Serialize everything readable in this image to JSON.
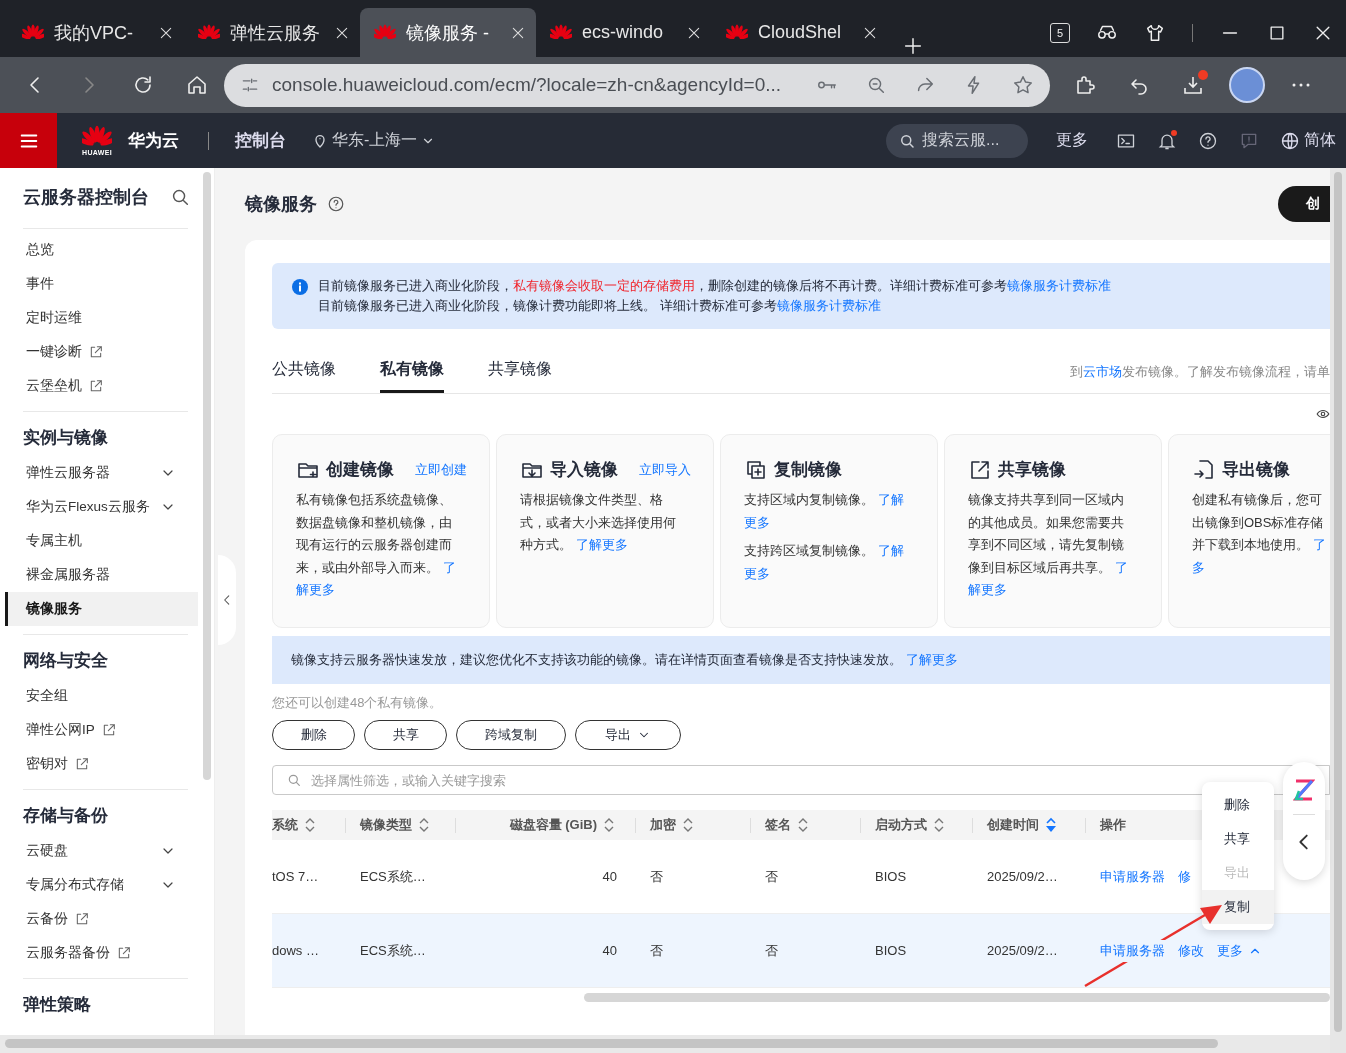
{
  "browser": {
    "tabs": [
      {
        "title": "我的VPC-",
        "selected": false
      },
      {
        "title": "弹性云服务",
        "selected": false
      },
      {
        "title": "镜像服务 -",
        "selected": true
      },
      {
        "title": "ecs-windo",
        "selected": false
      },
      {
        "title": "CloudShel",
        "selected": false
      }
    ],
    "tab_count": "5",
    "url": "console.huaweicloud.com/ecm/?locale=zh-cn&agencyId=0..."
  },
  "header": {
    "logo_text": "HUAWEI",
    "brand": "华为云",
    "console": "控制台",
    "region": "华东-上海一",
    "search_placeholder": "搜索云服...",
    "more": "更多",
    "language": "简体"
  },
  "sidebar": {
    "title": "云服务器控制台",
    "groups": [
      {
        "items": [
          {
            "label": "总览",
            "kind": "link",
            "selected": false
          },
          {
            "label": "事件",
            "kind": "link",
            "selected": false
          },
          {
            "label": "定时运维",
            "kind": "link",
            "selected": false
          },
          {
            "label": "一键诊断",
            "kind": "external",
            "selected": false
          },
          {
            "label": "云堡垒机",
            "kind": "external",
            "selected": false
          }
        ]
      },
      {
        "title": "实例与镜像",
        "items": [
          {
            "label": "弹性云服务器",
            "kind": "expandable",
            "selected": false
          },
          {
            "label": "华为云Flexus云服务",
            "kind": "expandable",
            "selected": false
          },
          {
            "label": "专属主机",
            "kind": "link",
            "selected": false
          },
          {
            "label": "裸金属服务器",
            "kind": "link",
            "selected": false
          },
          {
            "label": "镜像服务",
            "kind": "link",
            "selected": true
          }
        ]
      },
      {
        "title": "网络与安全",
        "items": [
          {
            "label": "安全组",
            "kind": "link",
            "selected": false
          },
          {
            "label": "弹性公网IP",
            "kind": "external",
            "selected": false
          },
          {
            "label": "密钥对",
            "kind": "external",
            "selected": false
          }
        ]
      },
      {
        "title": "存储与备份",
        "items": [
          {
            "label": "云硬盘",
            "kind": "expandable",
            "selected": false
          },
          {
            "label": "专属分布式存储",
            "kind": "expandable",
            "selected": false
          },
          {
            "label": "云备份",
            "kind": "external",
            "selected": false
          },
          {
            "label": "云服务器备份",
            "kind": "external",
            "selected": false
          }
        ]
      },
      {
        "title": "弹性策略"
      }
    ]
  },
  "page": {
    "title": "镜像服务",
    "create_button": "创"
  },
  "notice": [
    [
      {
        "kind": "text",
        "text": "目前镜像服务已进入商业化阶段，"
      },
      {
        "kind": "warning",
        "text": "私有镜像会收取一定的存储费用"
      },
      {
        "kind": "text",
        "text": "，删除创建的镜像后将不再计费。详细计费标准可参考"
      },
      {
        "kind": "link",
        "text": "镜像服务计费标准"
      }
    ],
    [
      {
        "kind": "text",
        "text": "目前镜像服务已进入商业化阶段，镜像计费功能即将上线。 详细计费标准可参考"
      },
      {
        "kind": "link",
        "text": "镜像服务计费标准"
      }
    ]
  ],
  "tabs": [
    {
      "label": "公共镜像",
      "selected": false
    },
    {
      "label": "私有镜像",
      "selected": true
    },
    {
      "label": "共享镜像",
      "selected": false
    }
  ],
  "marketplace_hint": [
    {
      "kind": "text",
      "text": "到"
    },
    {
      "kind": "link",
      "text": "云市场"
    },
    {
      "kind": "text",
      "text": "发布镜像。了解发布镜像流程，请单"
    }
  ],
  "cards": [
    {
      "kind": "create",
      "title": "创建镜像",
      "action": "立即创建",
      "paragraphs": [
        [
          [
            {
              "kind": "text",
              "text": "私有镜像包括系统盘镜像、"
            }
          ],
          [
            {
              "kind": "text",
              "text": "数据盘镜像和整机镜像，由"
            }
          ],
          [
            {
              "kind": "text",
              "text": "现有运行的云服务器创建而"
            }
          ],
          [
            {
              "kind": "text",
              "text": "来，或由外部导入而来。 "
            },
            {
              "kind": "link",
              "text": "了"
            }
          ],
          [
            {
              "kind": "link",
              "text": "解更多"
            }
          ]
        ]
      ]
    },
    {
      "kind": "import",
      "title": "导入镜像",
      "action": "立即导入",
      "paragraphs": [
        [
          [
            {
              "kind": "text",
              "text": "请根据镜像文件类型、格"
            }
          ],
          [
            {
              "kind": "text",
              "text": "式，或者大小来选择使用何"
            }
          ],
          [
            {
              "kind": "text",
              "text": "种方式。 "
            },
            {
              "kind": "link",
              "text": "了解更多"
            }
          ]
        ]
      ]
    },
    {
      "kind": "copy",
      "title": "复制镜像",
      "paragraphs": [
        [
          [
            {
              "kind": "text",
              "text": "支持区域内复制镜像。 "
            },
            {
              "kind": "link",
              "text": "了解"
            }
          ],
          [
            {
              "kind": "link",
              "text": "更多"
            }
          ]
        ],
        [
          [
            {
              "kind": "text",
              "text": "支持跨区域复制镜像。 "
            },
            {
              "kind": "link",
              "text": "了解"
            }
          ],
          [
            {
              "kind": "link",
              "text": "更多"
            }
          ]
        ]
      ]
    },
    {
      "kind": "share",
      "title": "共享镜像",
      "paragraphs": [
        [
          [
            {
              "kind": "text",
              "text": "镜像支持共享到同一区域内"
            }
          ],
          [
            {
              "kind": "text",
              "text": "的其他成员。如果您需要共"
            }
          ],
          [
            {
              "kind": "text",
              "text": "享到不同区域，请先复制镜"
            }
          ],
          [
            {
              "kind": "text",
              "text": "像到目标区域后再共享。 "
            },
            {
              "kind": "link",
              "text": "了"
            }
          ],
          [
            {
              "kind": "link",
              "text": "解更多"
            }
          ]
        ]
      ]
    },
    {
      "kind": "export",
      "title": "导出镜像",
      "paragraphs": [
        [
          [
            {
              "kind": "text",
              "text": "创建私有镜像后，您可"
            }
          ],
          [
            {
              "kind": "text",
              "text": "出镜像到OBS标准存储"
            }
          ],
          [
            {
              "kind": "text",
              "text": "并下载到本地使用。 "
            },
            {
              "kind": "link",
              "text": "了"
            }
          ],
          [
            {
              "kind": "link",
              "text": "多"
            }
          ]
        ]
      ]
    }
  ],
  "speed_notice": [
    {
      "kind": "text",
      "text": "镜像支持云服务器快速发放，建议您优化不支持该功能的镜像。请在详情页面查看镜像是否支持快速发放。 "
    },
    {
      "kind": "link",
      "text": "了解更多"
    }
  ],
  "quota": "您还可以创建48个私有镜像。",
  "buttons": [
    {
      "label": "删除",
      "kind": "plain"
    },
    {
      "label": "共享",
      "kind": "plain"
    },
    {
      "label": "跨域复制",
      "kind": "plain"
    },
    {
      "label": "导出",
      "kind": "dropdown"
    }
  ],
  "search": {
    "placeholder": "选择属性筛选，或输入关键字搜索"
  },
  "table": {
    "columns": [
      {
        "label": "系统",
        "sortable": true,
        "sorted": false
      },
      {
        "label": "镜像类型",
        "sortable": true,
        "sorted": false
      },
      {
        "label": "磁盘容量 (GiB)",
        "sortable": true,
        "sorted": false
      },
      {
        "label": "加密",
        "sortable": true,
        "sorted": false
      },
      {
        "label": "签名",
        "sortable": true,
        "sorted": false
      },
      {
        "label": "启动方式",
        "sortable": true,
        "sorted": false
      },
      {
        "label": "创建时间",
        "sortable": true,
        "sorted": true
      },
      {
        "label": "操作",
        "sortable": false
      }
    ],
    "rows": [
      {
        "selected": false,
        "cells": [
          "tOS 7…",
          "ECS系统…",
          "40",
          "否",
          "否",
          "BIOS",
          "2025/09/2…"
        ],
        "actions": [
          {
            "label": "申请服务器",
            "kind": "link"
          },
          {
            "label": "修",
            "kind": "link"
          }
        ]
      },
      {
        "selected": true,
        "cells": [
          "dows …",
          "ECS系统…",
          "40",
          "否",
          "否",
          "BIOS",
          "2025/09/2…"
        ],
        "actions": [
          {
            "label": "申请服务器",
            "kind": "link"
          },
          {
            "label": "修改",
            "kind": "link"
          },
          {
            "label": "更多",
            "kind": "menu",
            "expanded": true
          }
        ]
      }
    ]
  },
  "menu": [
    {
      "label": "删除",
      "disabled": false,
      "selected": false
    },
    {
      "label": "共享",
      "disabled": false,
      "selected": false
    },
    {
      "label": "导出",
      "disabled": true,
      "selected": false
    },
    {
      "label": "复制",
      "disabled": false,
      "selected": true
    }
  ]
}
